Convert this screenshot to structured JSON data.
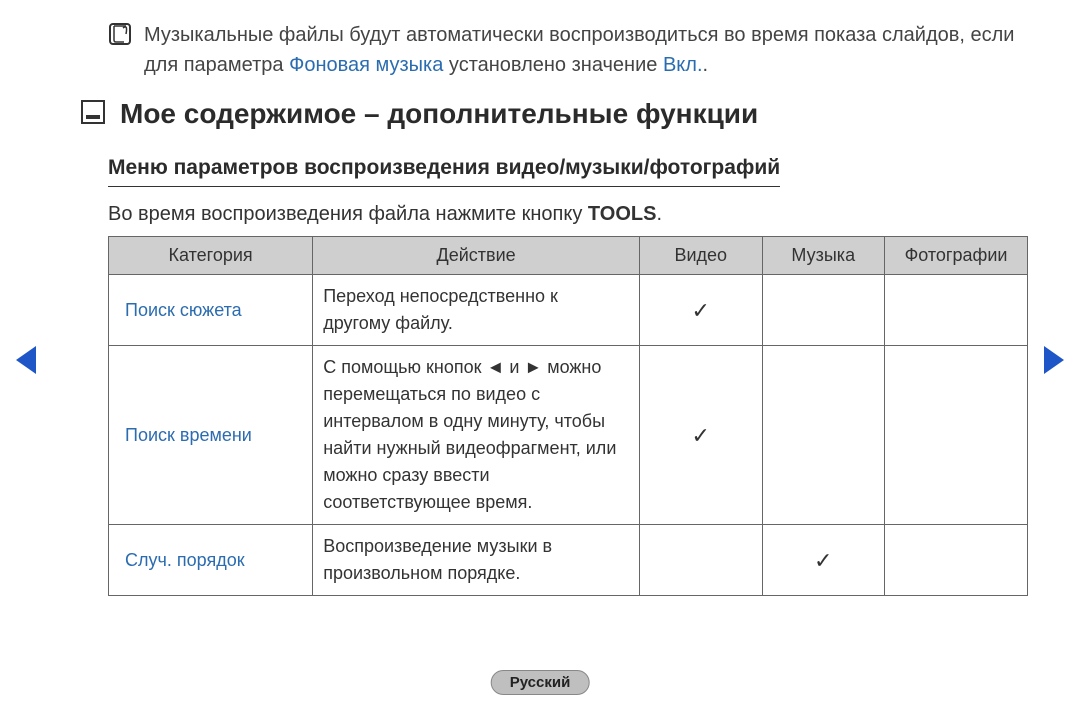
{
  "note": {
    "pre": "Музыкальные файлы будут автоматически воспроизводиться во время показа слайдов, если для параметра",
    "hl1": "Фоновая музыка",
    "mid": "установлено значение",
    "hl2": "Вкл.",
    "suffix": "."
  },
  "section_title": "Мое содержимое – дополнительные функции",
  "subheading": "Меню параметров воспроизведения видео/музыки/фотографий",
  "intro_pre": "Во время воспроизведения файла нажмите кнопку",
  "intro_btn": "TOOLS",
  "intro_suffix": ".",
  "table": {
    "headers": {
      "category": "Категория",
      "action": "Действие",
      "video": "Видео",
      "music": "Музыка",
      "photo": "Фотографии"
    },
    "rows": [
      {
        "category": "Поиск сюжета",
        "action": "Переход непосредственно к другому файлу.",
        "video": "✓",
        "music": "",
        "photo": ""
      },
      {
        "category": "Поиск времени",
        "action": "С помощью кнопок ◄ и ► можно перемещаться по видео с интервалом в одну минуту, чтобы найти нужный видеофрагмент, или можно сразу ввести соответствующее время.",
        "video": "✓",
        "music": "",
        "photo": ""
      },
      {
        "category": "Случ. порядок",
        "action": "Воспроизведение музыки в произвольном порядке.",
        "video": "",
        "music": "✓",
        "photo": ""
      }
    ]
  },
  "language": "Русский"
}
